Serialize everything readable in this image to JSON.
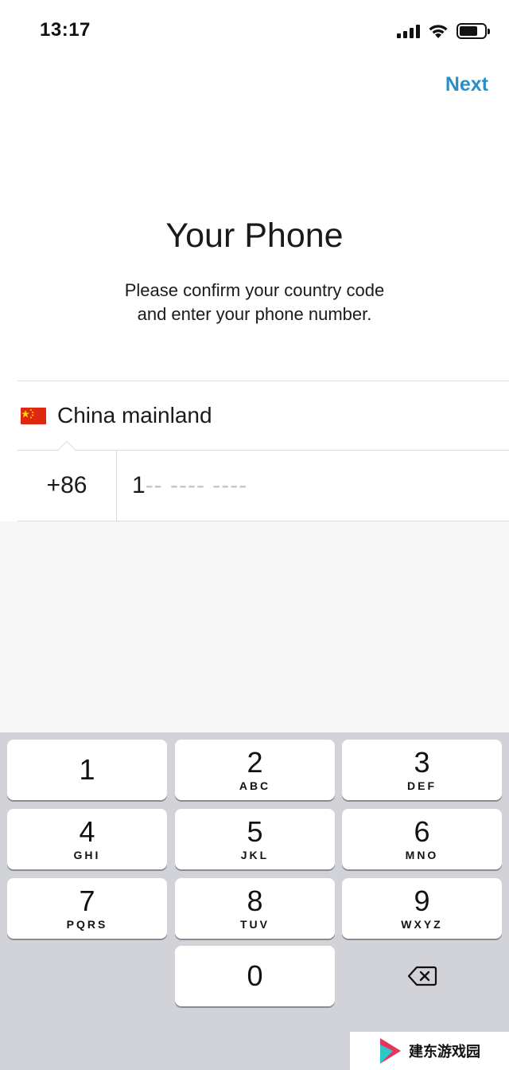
{
  "status_bar": {
    "time": "13:17",
    "icons": [
      "signal-icon",
      "wifi-icon",
      "battery-icon"
    ]
  },
  "nav": {
    "next_label": "Next",
    "accent_color": "#2a8fc7"
  },
  "header": {
    "title": "Your Phone",
    "subtitle_line1": "Please confirm your country code",
    "subtitle_line2": "and enter your phone number."
  },
  "form": {
    "country_flag": "china-flag-icon",
    "country_name": "China mainland",
    "country_code": "+86",
    "phone_value": "1",
    "phone_mask": "-- ---- ----"
  },
  "keypad": {
    "keys": [
      {
        "digit": "1",
        "letters": ""
      },
      {
        "digit": "2",
        "letters": "ABC"
      },
      {
        "digit": "3",
        "letters": "DEF"
      },
      {
        "digit": "4",
        "letters": "GHI"
      },
      {
        "digit": "5",
        "letters": "JKL"
      },
      {
        "digit": "6",
        "letters": "MNO"
      },
      {
        "digit": "7",
        "letters": "PQRS"
      },
      {
        "digit": "8",
        "letters": "TUV"
      },
      {
        "digit": "9",
        "letters": "WXYZ"
      },
      {
        "digit": "0",
        "letters": ""
      }
    ],
    "delete_icon": "backspace-icon"
  },
  "watermark": {
    "text": "建东游戏园"
  }
}
